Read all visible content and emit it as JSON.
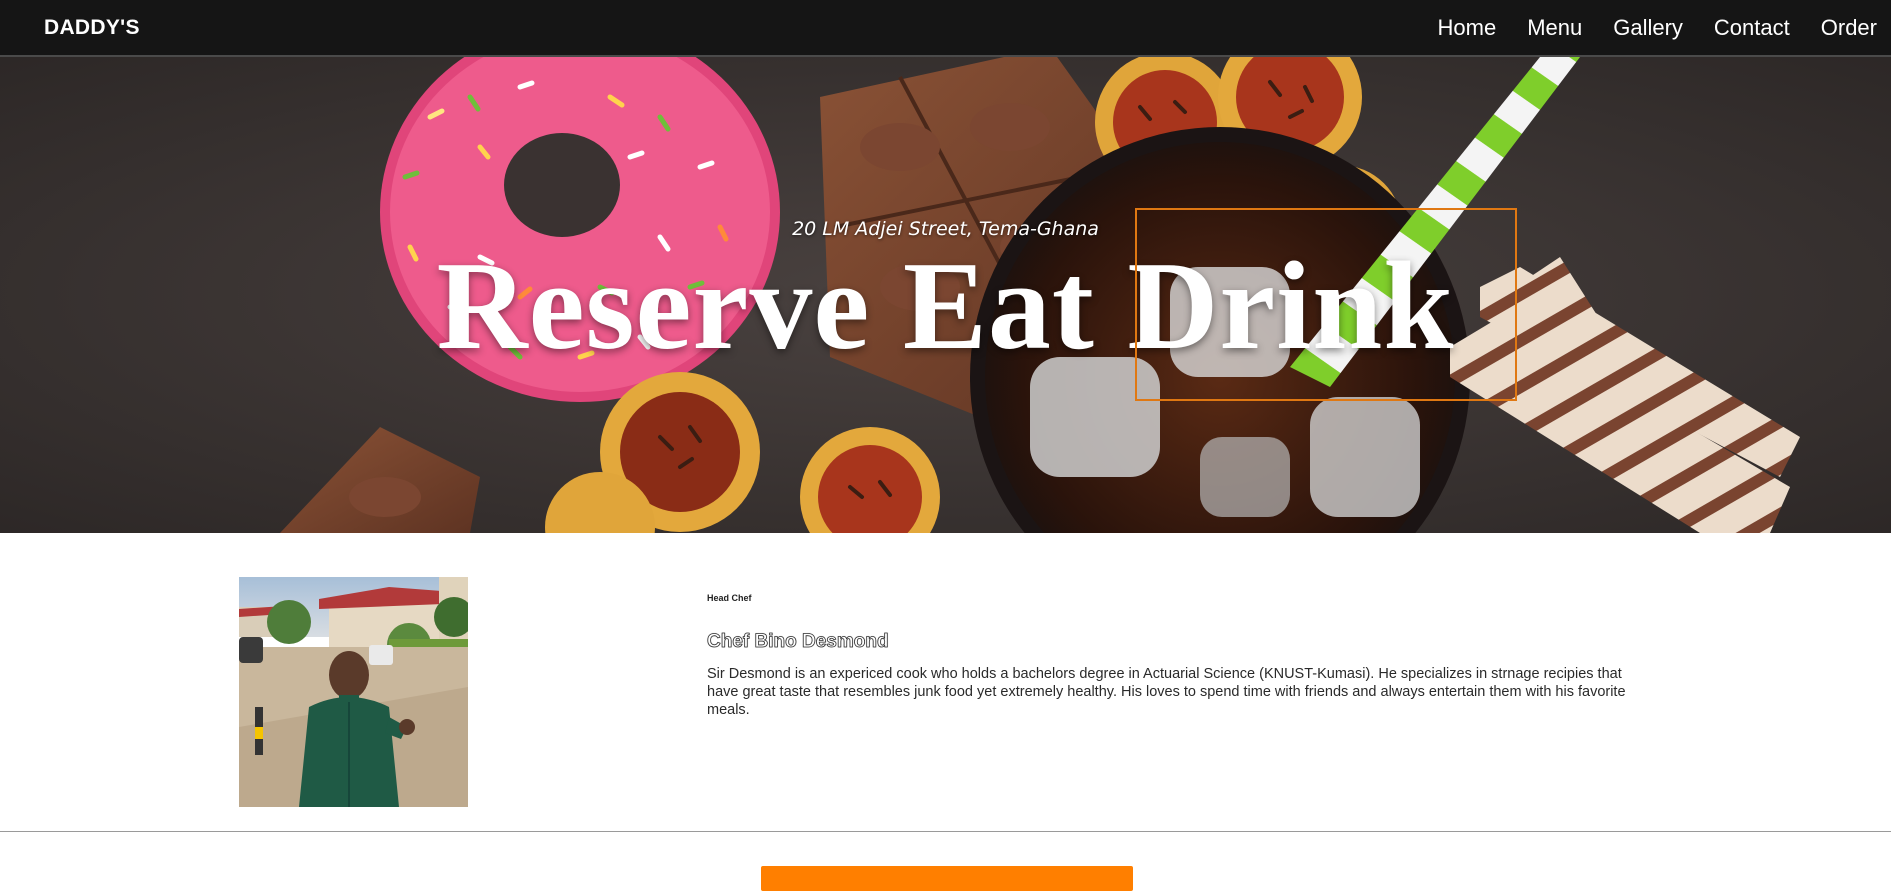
{
  "navbar": {
    "brand": "DADDY'S",
    "links": [
      "Home",
      "Menu",
      "Gallery",
      "Contact",
      "Order"
    ]
  },
  "hero": {
    "address": "20 LM Adjei Street, Tema-Ghana",
    "title": "Reserve Eat Drink"
  },
  "chef": {
    "role": "Head Chef",
    "name": "Chef Bino Desmond",
    "bio": "Sir Desmond is an expericed cook who holds a bachelors degree in Actuarial Science (KNUST-Kumasi). He specializes in strnage recipies that have great taste that resembles junk food yet extremely healthy. His loves to spend time with friends and always entertain them with his favorite meals."
  },
  "colors": {
    "navbar_bg": "#151515",
    "accent": "#ff7f00",
    "focus_outline": "#e07812"
  }
}
